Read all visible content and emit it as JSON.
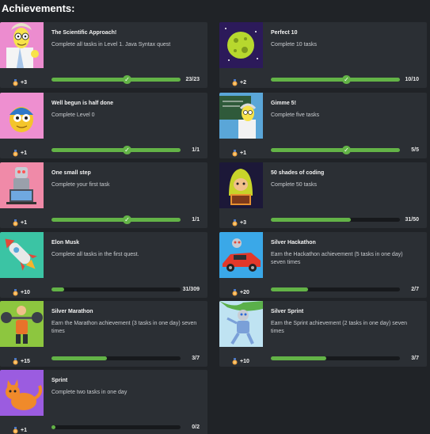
{
  "page": {
    "heading": "Achievements:"
  },
  "colors": {
    "background": "#202327",
    "card": "#2b2f34",
    "progress": "#63b347",
    "track": "#17191c"
  },
  "achievements": [
    {
      "title": "The Scientific Approach!",
      "description": "Complete all tasks in Level 1. Java Syntax quest",
      "reward": "+3",
      "progress_text": "23/23",
      "progress": 1.0,
      "completed": true,
      "icon": "scientist-icon"
    },
    {
      "title": "Perfect 10",
      "description": "Complete 10 tasks",
      "reward": "+2",
      "progress_text": "10/10",
      "progress": 1.0,
      "completed": true,
      "icon": "planet-icon"
    },
    {
      "title": "Well begun is half done",
      "description": "Complete Level 0",
      "reward": "+1",
      "progress_text": "1/1",
      "progress": 1.0,
      "completed": true,
      "icon": "robot-ball-icon"
    },
    {
      "title": "Gimme 5!",
      "description": "Complete five tasks",
      "reward": "+1",
      "progress_text": "5/5",
      "progress": 1.0,
      "completed": true,
      "icon": "professor-chalkboard-icon"
    },
    {
      "title": "One small step",
      "description": "Complete your first task",
      "reward": "+1",
      "progress_text": "1/1",
      "progress": 1.0,
      "completed": true,
      "icon": "robot-laptop-icon"
    },
    {
      "title": "50 shades of coding",
      "description": "Complete 50 tasks",
      "reward": "+3",
      "progress_text": "31/50",
      "progress": 0.62,
      "completed": false,
      "icon": "hooded-coder-icon"
    },
    {
      "title": "Elon Musk",
      "description": "Complete all tasks in the first quest.",
      "reward": "+10",
      "progress_text": "31/309",
      "progress": 0.1,
      "completed": false,
      "icon": "rocket-icon"
    },
    {
      "title": "Silver Hackathon",
      "description": "Earn the Hackathon achievement (5 tasks in one day) seven times",
      "reward": "+20",
      "progress_text": "2/7",
      "progress": 0.29,
      "completed": false,
      "icon": "race-car-icon"
    },
    {
      "title": "Silver Marathon",
      "description": "Earn the Marathon achievement (3 tasks in one day) seven times",
      "reward": "+15",
      "progress_text": "3/7",
      "progress": 0.43,
      "completed": false,
      "icon": "weightlifter-icon"
    },
    {
      "title": "Silver Sprint",
      "description": "Earn the Sprint achievement (2 tasks in one day) seven times",
      "reward": "+10",
      "progress_text": "3/7",
      "progress": 0.43,
      "completed": false,
      "icon": "runner-robot-icon"
    },
    {
      "title": "Sprint",
      "description": "Complete two tasks in one day",
      "reward": "+1",
      "progress_text": "0/2",
      "progress": 0.0,
      "completed": false,
      "icon": "cat-icon"
    }
  ]
}
